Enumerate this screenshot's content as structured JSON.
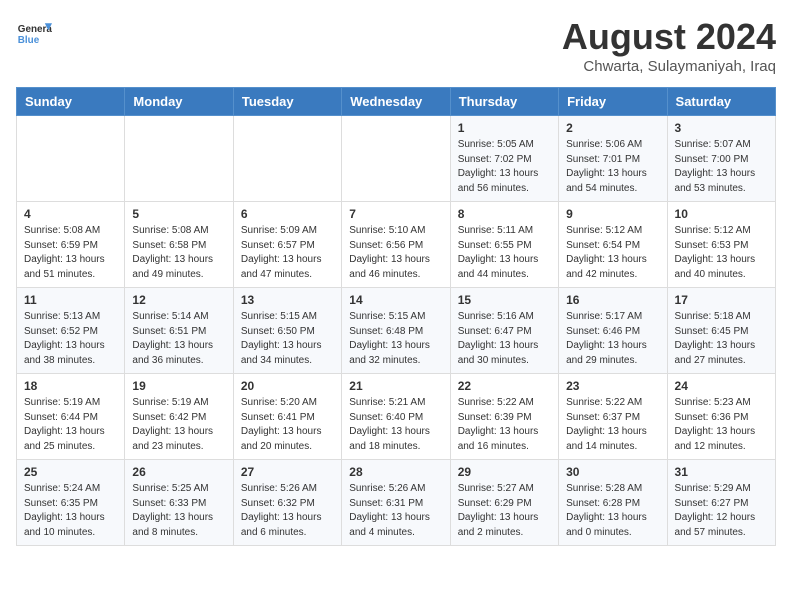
{
  "header": {
    "logo_general": "General",
    "logo_blue": "Blue",
    "month_year": "August 2024",
    "location": "Chwarta, Sulaymaniyah, Iraq"
  },
  "days_of_week": [
    "Sunday",
    "Monday",
    "Tuesday",
    "Wednesday",
    "Thursday",
    "Friday",
    "Saturday"
  ],
  "weeks": [
    [
      {
        "day": "",
        "info": ""
      },
      {
        "day": "",
        "info": ""
      },
      {
        "day": "",
        "info": ""
      },
      {
        "day": "",
        "info": ""
      },
      {
        "day": "1",
        "info": "Sunrise: 5:05 AM\nSunset: 7:02 PM\nDaylight: 13 hours\nand 56 minutes."
      },
      {
        "day": "2",
        "info": "Sunrise: 5:06 AM\nSunset: 7:01 PM\nDaylight: 13 hours\nand 54 minutes."
      },
      {
        "day": "3",
        "info": "Sunrise: 5:07 AM\nSunset: 7:00 PM\nDaylight: 13 hours\nand 53 minutes."
      }
    ],
    [
      {
        "day": "4",
        "info": "Sunrise: 5:08 AM\nSunset: 6:59 PM\nDaylight: 13 hours\nand 51 minutes."
      },
      {
        "day": "5",
        "info": "Sunrise: 5:08 AM\nSunset: 6:58 PM\nDaylight: 13 hours\nand 49 minutes."
      },
      {
        "day": "6",
        "info": "Sunrise: 5:09 AM\nSunset: 6:57 PM\nDaylight: 13 hours\nand 47 minutes."
      },
      {
        "day": "7",
        "info": "Sunrise: 5:10 AM\nSunset: 6:56 PM\nDaylight: 13 hours\nand 46 minutes."
      },
      {
        "day": "8",
        "info": "Sunrise: 5:11 AM\nSunset: 6:55 PM\nDaylight: 13 hours\nand 44 minutes."
      },
      {
        "day": "9",
        "info": "Sunrise: 5:12 AM\nSunset: 6:54 PM\nDaylight: 13 hours\nand 42 minutes."
      },
      {
        "day": "10",
        "info": "Sunrise: 5:12 AM\nSunset: 6:53 PM\nDaylight: 13 hours\nand 40 minutes."
      }
    ],
    [
      {
        "day": "11",
        "info": "Sunrise: 5:13 AM\nSunset: 6:52 PM\nDaylight: 13 hours\nand 38 minutes."
      },
      {
        "day": "12",
        "info": "Sunrise: 5:14 AM\nSunset: 6:51 PM\nDaylight: 13 hours\nand 36 minutes."
      },
      {
        "day": "13",
        "info": "Sunrise: 5:15 AM\nSunset: 6:50 PM\nDaylight: 13 hours\nand 34 minutes."
      },
      {
        "day": "14",
        "info": "Sunrise: 5:15 AM\nSunset: 6:48 PM\nDaylight: 13 hours\nand 32 minutes."
      },
      {
        "day": "15",
        "info": "Sunrise: 5:16 AM\nSunset: 6:47 PM\nDaylight: 13 hours\nand 30 minutes."
      },
      {
        "day": "16",
        "info": "Sunrise: 5:17 AM\nSunset: 6:46 PM\nDaylight: 13 hours\nand 29 minutes."
      },
      {
        "day": "17",
        "info": "Sunrise: 5:18 AM\nSunset: 6:45 PM\nDaylight: 13 hours\nand 27 minutes."
      }
    ],
    [
      {
        "day": "18",
        "info": "Sunrise: 5:19 AM\nSunset: 6:44 PM\nDaylight: 13 hours\nand 25 minutes."
      },
      {
        "day": "19",
        "info": "Sunrise: 5:19 AM\nSunset: 6:42 PM\nDaylight: 13 hours\nand 23 minutes."
      },
      {
        "day": "20",
        "info": "Sunrise: 5:20 AM\nSunset: 6:41 PM\nDaylight: 13 hours\nand 20 minutes."
      },
      {
        "day": "21",
        "info": "Sunrise: 5:21 AM\nSunset: 6:40 PM\nDaylight: 13 hours\nand 18 minutes."
      },
      {
        "day": "22",
        "info": "Sunrise: 5:22 AM\nSunset: 6:39 PM\nDaylight: 13 hours\nand 16 minutes."
      },
      {
        "day": "23",
        "info": "Sunrise: 5:22 AM\nSunset: 6:37 PM\nDaylight: 13 hours\nand 14 minutes."
      },
      {
        "day": "24",
        "info": "Sunrise: 5:23 AM\nSunset: 6:36 PM\nDaylight: 13 hours\nand 12 minutes."
      }
    ],
    [
      {
        "day": "25",
        "info": "Sunrise: 5:24 AM\nSunset: 6:35 PM\nDaylight: 13 hours\nand 10 minutes."
      },
      {
        "day": "26",
        "info": "Sunrise: 5:25 AM\nSunset: 6:33 PM\nDaylight: 13 hours\nand 8 minutes."
      },
      {
        "day": "27",
        "info": "Sunrise: 5:26 AM\nSunset: 6:32 PM\nDaylight: 13 hours\nand 6 minutes."
      },
      {
        "day": "28",
        "info": "Sunrise: 5:26 AM\nSunset: 6:31 PM\nDaylight: 13 hours\nand 4 minutes."
      },
      {
        "day": "29",
        "info": "Sunrise: 5:27 AM\nSunset: 6:29 PM\nDaylight: 13 hours\nand 2 minutes."
      },
      {
        "day": "30",
        "info": "Sunrise: 5:28 AM\nSunset: 6:28 PM\nDaylight: 13 hours\nand 0 minutes."
      },
      {
        "day": "31",
        "info": "Sunrise: 5:29 AM\nSunset: 6:27 PM\nDaylight: 12 hours\nand 57 minutes."
      }
    ]
  ]
}
